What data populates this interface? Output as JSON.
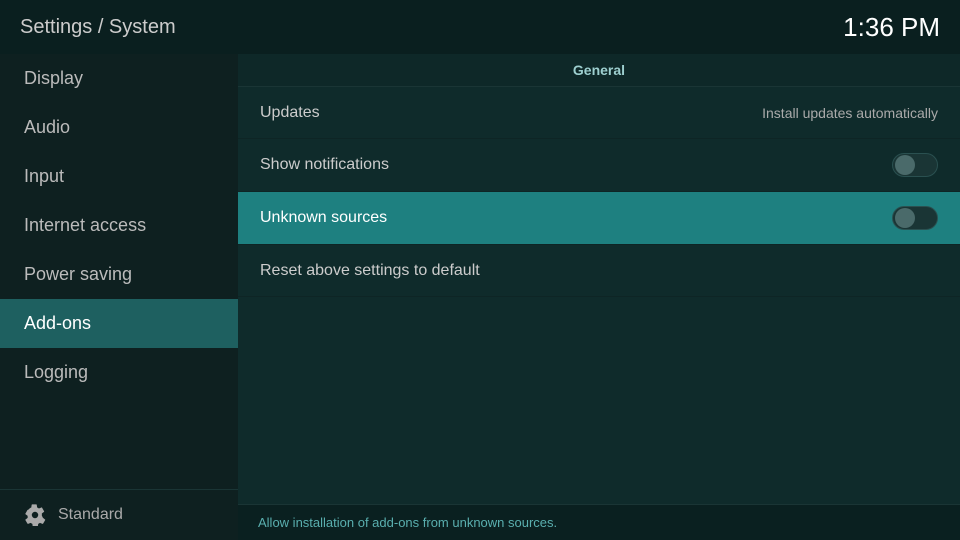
{
  "header": {
    "title": "Settings / System",
    "time": "1:36 PM"
  },
  "sidebar": {
    "items": [
      {
        "id": "display",
        "label": "Display"
      },
      {
        "id": "audio",
        "label": "Audio"
      },
      {
        "id": "input",
        "label": "Input"
      },
      {
        "id": "internet-access",
        "label": "Internet access"
      },
      {
        "id": "power-saving",
        "label": "Power saving"
      },
      {
        "id": "add-ons",
        "label": "Add-ons",
        "active": true
      },
      {
        "id": "logging",
        "label": "Logging"
      }
    ],
    "bottom_label": "Standard"
  },
  "content": {
    "section_label": "General",
    "settings": [
      {
        "id": "updates",
        "label": "Updates",
        "value": "Install updates automatically",
        "toggle": null
      },
      {
        "id": "show-notifications",
        "label": "Show notifications",
        "value": null,
        "toggle": true,
        "toggle_on": false
      },
      {
        "id": "unknown-sources",
        "label": "Unknown sources",
        "value": null,
        "toggle": true,
        "toggle_on": false,
        "highlighted": true
      },
      {
        "id": "reset-settings",
        "label": "Reset above settings to default",
        "value": null,
        "toggle": null
      }
    ],
    "status_text": "Allow installation of add-ons from unknown sources."
  }
}
